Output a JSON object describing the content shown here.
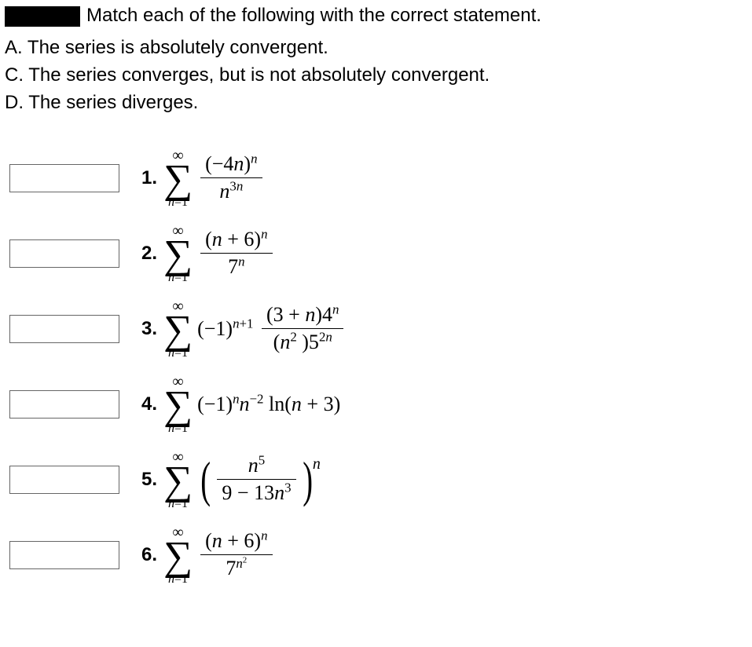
{
  "header": {
    "prompt": "Match each of the following with the correct statement."
  },
  "options": {
    "A": "A. The series is absolutely convergent.",
    "C": "C. The series converges, but is not absolutely convergent.",
    "D": "D. The series diverges."
  },
  "sigma": {
    "upper": "∞",
    "symbol": "∑",
    "lower_var": "n",
    "lower_eq": "=1"
  },
  "problems": [
    {
      "num": "1.",
      "type": "frac",
      "top_html": "(−4<span class='it'>n</span>)<sup><span class='it'>n</span></sup>",
      "bot_html": "<span class='it'>n</span><sup>3<span class='it'>n</span></sup>"
    },
    {
      "num": "2.",
      "type": "frac",
      "top_html": "(<span class='it'>n</span> + 6)<sup><span class='it'>n</span></sup>",
      "bot_html": "7<sup><span class='it'>n</span></sup>"
    },
    {
      "num": "3.",
      "type": "prefix_frac",
      "prefix_html": "(−1)<sup><span class='it'>n</span>+1</sup>",
      "top_html": "(3 + <span class='it'>n</span>)4<sup><span class='it'>n</span></sup>",
      "bot_html": "(<span class='it'>n</span><sup>2</sup> )5<sup>2<span class='it'>n</span></sup>"
    },
    {
      "num": "4.",
      "type": "plain",
      "body_html": "(−1)<sup><span class='it'>n</span></sup><span class='it'>n</span><sup>−2</sup>&nbsp;ln(<span class='it'>n</span> + 3)"
    },
    {
      "num": "5.",
      "type": "paren_frac_exp",
      "top_html": "<span class='it'>n</span><sup>5</sup>",
      "bot_html": "9 − 13<span class='it'>n</span><sup>3</sup>",
      "exp_html": "n"
    },
    {
      "num": "6.",
      "type": "frac",
      "top_html": "(<span class='it'>n</span> + 6)<sup><span class='it'>n</span></sup>",
      "bot_html": "7<sup><span class='it'>n</span><sup>2</sup></sup>"
    }
  ]
}
